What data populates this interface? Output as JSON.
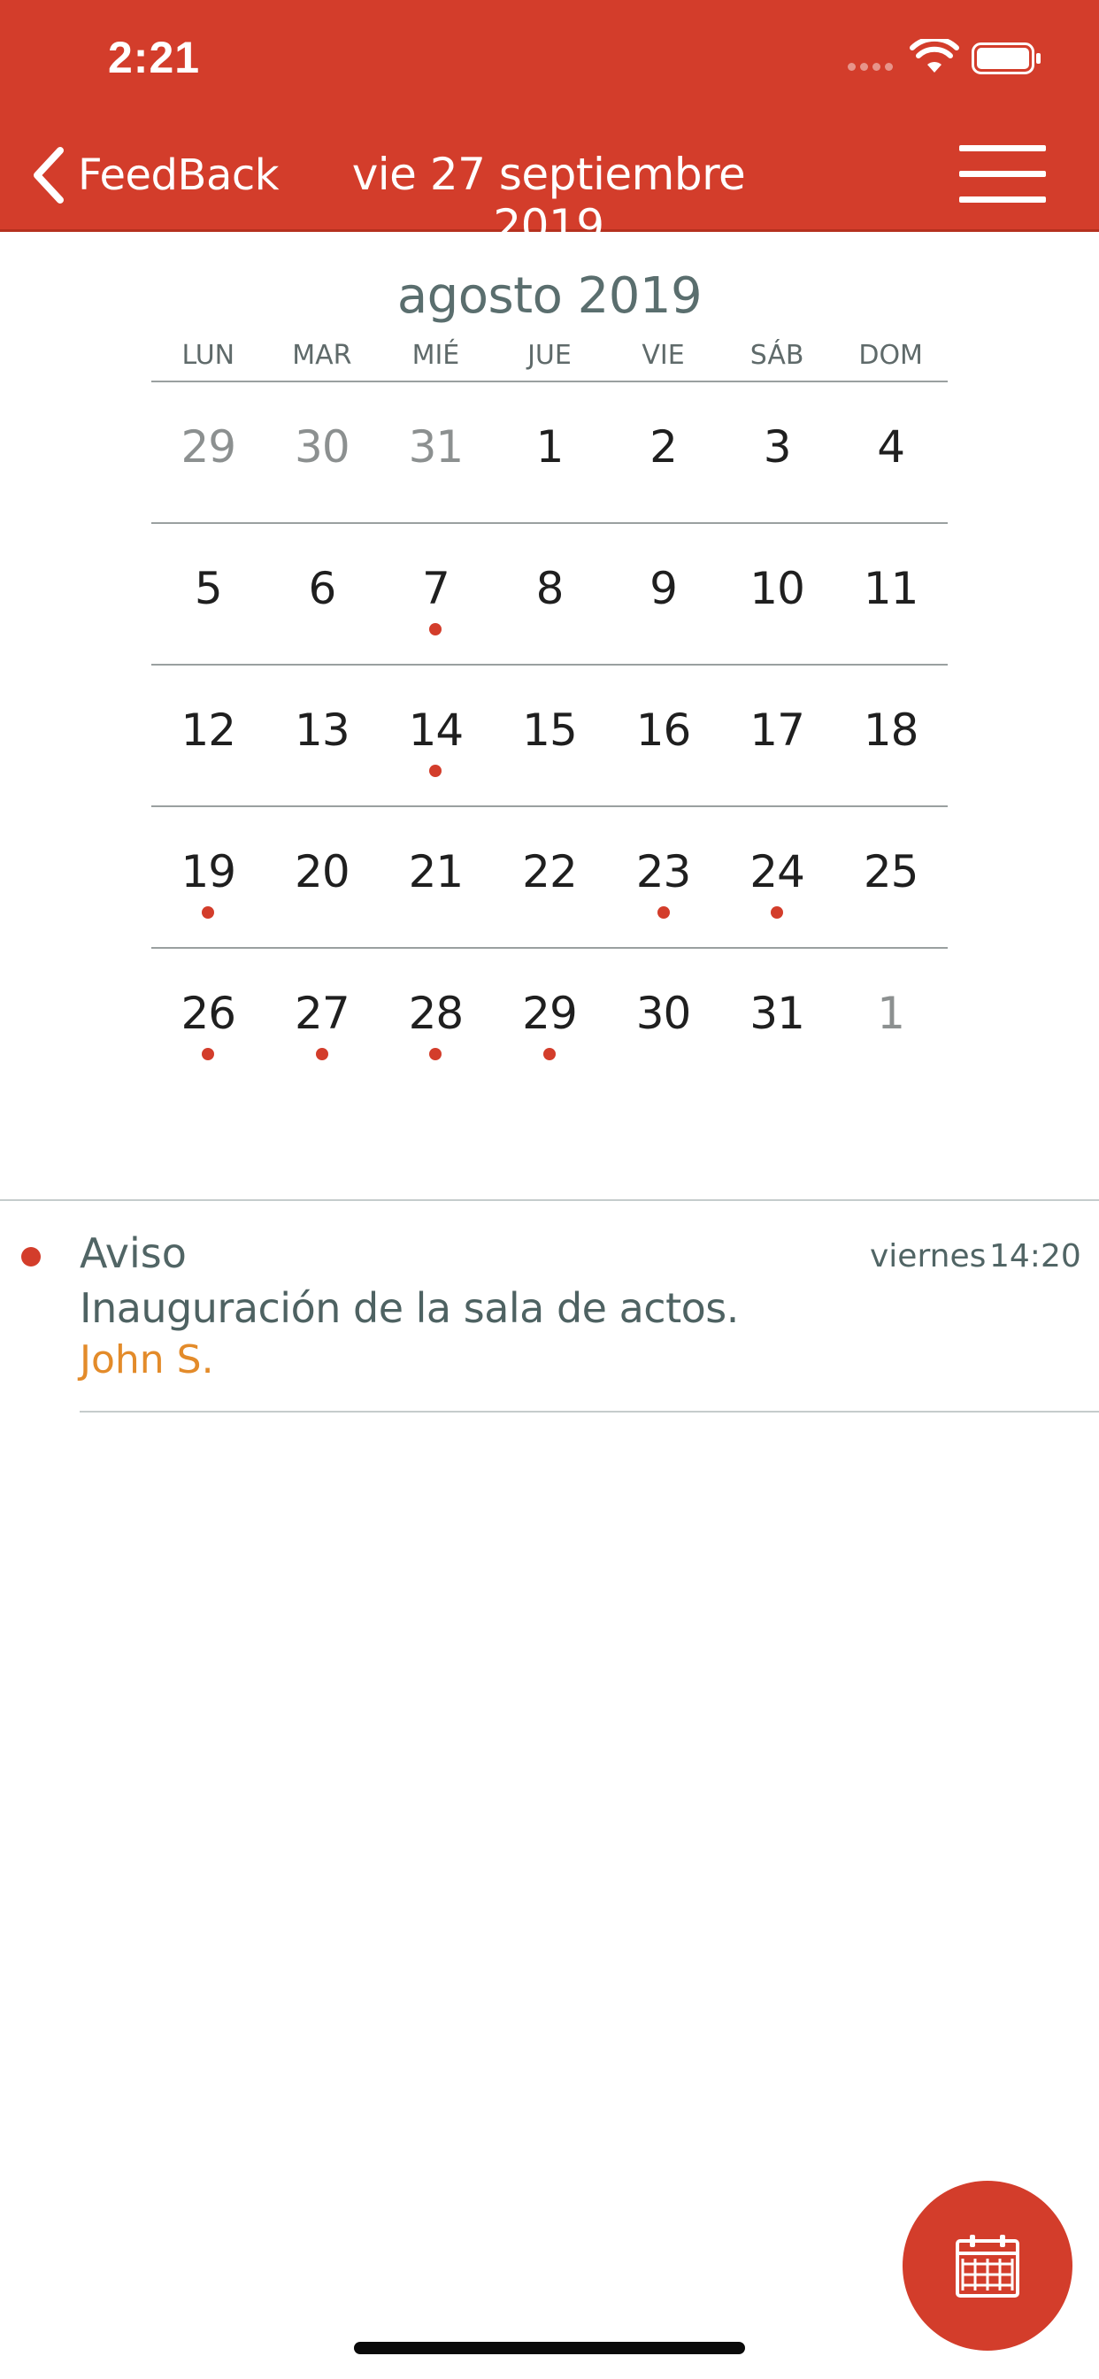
{
  "status_bar": {
    "time": "2:21"
  },
  "nav": {
    "back_label": "FeedBack",
    "title": "vie 27 septiembre 2019"
  },
  "calendar": {
    "month_title": "agosto 2019",
    "weekdays": [
      "LUN",
      "MAR",
      "MIÉ",
      "JUE",
      "VIE",
      "SÁB",
      "DOM"
    ],
    "weeks": [
      [
        {
          "day": "29",
          "other": true,
          "event": false
        },
        {
          "day": "30",
          "other": true,
          "event": false
        },
        {
          "day": "31",
          "other": true,
          "event": false
        },
        {
          "day": "1",
          "other": false,
          "event": false
        },
        {
          "day": "2",
          "other": false,
          "event": false
        },
        {
          "day": "3",
          "other": false,
          "event": false
        },
        {
          "day": "4",
          "other": false,
          "event": false
        }
      ],
      [
        {
          "day": "5",
          "other": false,
          "event": false
        },
        {
          "day": "6",
          "other": false,
          "event": false
        },
        {
          "day": "7",
          "other": false,
          "event": true
        },
        {
          "day": "8",
          "other": false,
          "event": false
        },
        {
          "day": "9",
          "other": false,
          "event": false
        },
        {
          "day": "10",
          "other": false,
          "event": false
        },
        {
          "day": "11",
          "other": false,
          "event": false
        }
      ],
      [
        {
          "day": "12",
          "other": false,
          "event": false
        },
        {
          "day": "13",
          "other": false,
          "event": false
        },
        {
          "day": "14",
          "other": false,
          "event": true
        },
        {
          "day": "15",
          "other": false,
          "event": false
        },
        {
          "day": "16",
          "other": false,
          "event": false
        },
        {
          "day": "17",
          "other": false,
          "event": false
        },
        {
          "day": "18",
          "other": false,
          "event": false
        }
      ],
      [
        {
          "day": "19",
          "other": false,
          "event": true
        },
        {
          "day": "20",
          "other": false,
          "event": false
        },
        {
          "day": "21",
          "other": false,
          "event": false
        },
        {
          "day": "22",
          "other": false,
          "event": false
        },
        {
          "day": "23",
          "other": false,
          "event": true
        },
        {
          "day": "24",
          "other": false,
          "event": true
        },
        {
          "day": "25",
          "other": false,
          "event": false
        }
      ],
      [
        {
          "day": "26",
          "other": false,
          "event": true
        },
        {
          "day": "27",
          "other": false,
          "event": true
        },
        {
          "day": "28",
          "other": false,
          "event": true
        },
        {
          "day": "29",
          "other": false,
          "event": true
        },
        {
          "day": "30",
          "other": false,
          "event": false
        },
        {
          "day": "31",
          "other": false,
          "event": false
        },
        {
          "day": "1",
          "other": true,
          "event": false
        }
      ]
    ]
  },
  "events": [
    {
      "type": "Aviso",
      "day": "viernes",
      "time": "14:20",
      "description": "Inauguración de la sala de actos.",
      "author": "John S."
    }
  ],
  "colors": {
    "accent": "#d33d2b",
    "text_muted": "#516565",
    "author": "#e38b2a"
  },
  "icons": {
    "back": "chevron-left-icon",
    "menu": "hamburger-menu-icon",
    "fab": "calendar-icon"
  }
}
